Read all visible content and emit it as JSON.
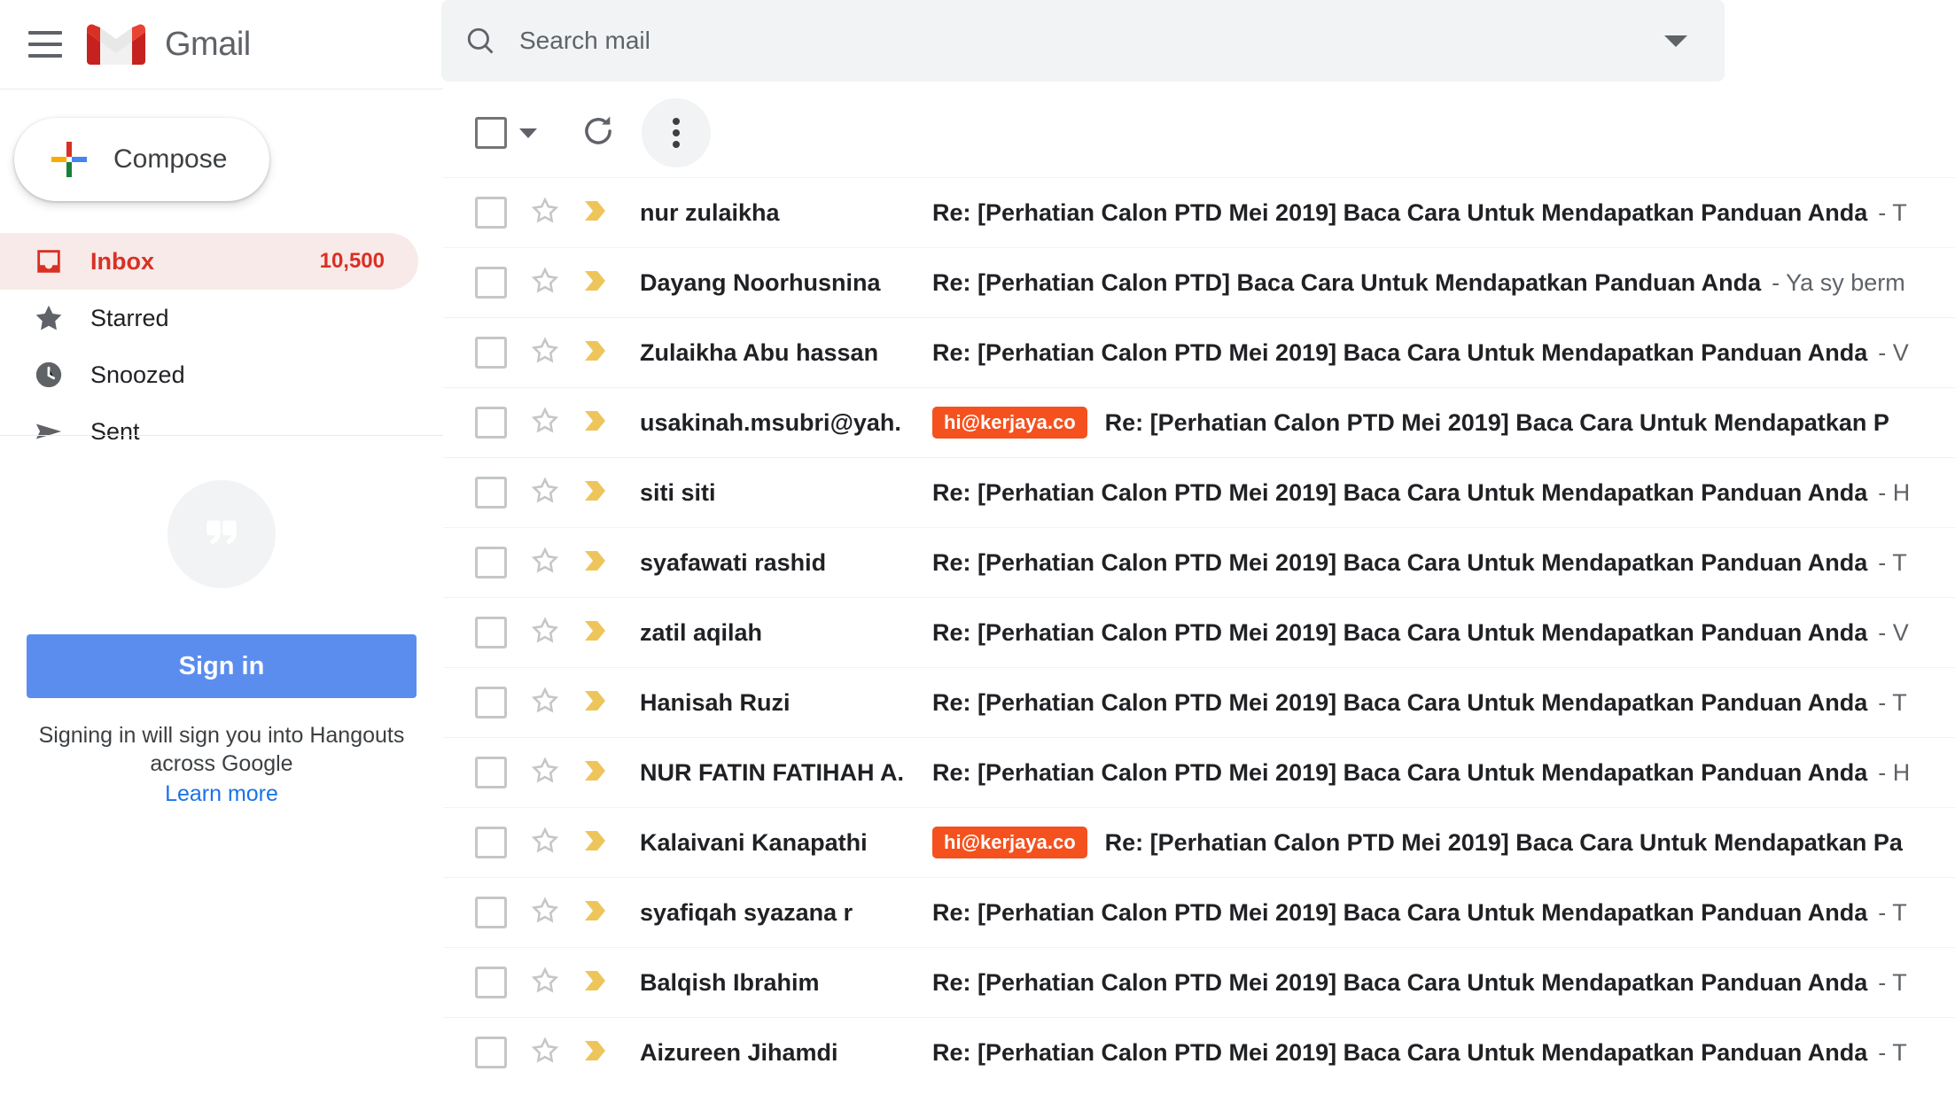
{
  "app": {
    "name": "Gmail",
    "menu_icon": "hamburger-menu-icon",
    "logo_icon": "gmail-logo-icon"
  },
  "search": {
    "placeholder": "Search mail",
    "value": "",
    "icon": "search-icon",
    "options_icon": "chevron-down-icon"
  },
  "sidebar": {
    "compose": {
      "label": "Compose",
      "icon": "plus-icon"
    },
    "items": [
      {
        "label": "Inbox",
        "icon": "inbox-icon",
        "count": "10,500",
        "active": true
      },
      {
        "label": "Starred",
        "icon": "star-icon",
        "count": "",
        "active": false
      },
      {
        "label": "Snoozed",
        "icon": "clock-icon",
        "count": "",
        "active": false
      },
      {
        "label": "Sent",
        "icon": "send-icon",
        "count": "",
        "active": false
      }
    ],
    "hangouts": {
      "icon": "hangouts-quote-icon",
      "signin_label": "Sign in",
      "note": "Signing in will sign you into Hangouts across Google",
      "learn_more": "Learn more"
    }
  },
  "toolbar": {
    "select_all_icon": "checkbox-icon",
    "select_dropdown_icon": "chevron-down-icon",
    "refresh_icon": "refresh-icon",
    "more_icon": "more-vertical-icon"
  },
  "mail_list": {
    "rows": [
      {
        "sender": "nur zulaikha",
        "chip": "",
        "subject": "Re: [Perhatian Calon PTD Mei 2019] Baca Cara Untuk Mendapatkan Panduan Anda",
        "snippet": "- T"
      },
      {
        "sender": "Dayang Noorhusnina",
        "chip": "",
        "subject": "Re: [Perhatian Calon PTD] Baca Cara Untuk Mendapatkan Panduan Anda",
        "snippet": "- Ya sy berm"
      },
      {
        "sender": "Zulaikha Abu hassan",
        "chip": "",
        "subject": "Re: [Perhatian Calon PTD Mei 2019] Baca Cara Untuk Mendapatkan Panduan Anda",
        "snippet": "- V"
      },
      {
        "sender": "usakinah.msubri@yah.",
        "chip": "hi@kerjaya.co",
        "subject": "Re: [Perhatian Calon PTD Mei 2019] Baca Cara Untuk Mendapatkan P",
        "snippet": ""
      },
      {
        "sender": "siti siti",
        "chip": "",
        "subject": "Re: [Perhatian Calon PTD Mei 2019] Baca Cara Untuk Mendapatkan Panduan Anda",
        "snippet": "- H"
      },
      {
        "sender": "syafawati rashid",
        "chip": "",
        "subject": "Re: [Perhatian Calon PTD Mei 2019] Baca Cara Untuk Mendapatkan Panduan Anda",
        "snippet": "- T"
      },
      {
        "sender": "zatil aqilah",
        "chip": "",
        "subject": "Re: [Perhatian Calon PTD Mei 2019] Baca Cara Untuk Mendapatkan Panduan Anda",
        "snippet": "- V"
      },
      {
        "sender": "Hanisah Ruzi",
        "chip": "",
        "subject": "Re: [Perhatian Calon PTD Mei 2019] Baca Cara Untuk Mendapatkan Panduan Anda",
        "snippet": "- T"
      },
      {
        "sender": "NUR FATIN FATIHAH A.",
        "chip": "",
        "subject": "Re: [Perhatian Calon PTD Mei 2019] Baca Cara Untuk Mendapatkan Panduan Anda",
        "snippet": "- H"
      },
      {
        "sender": "Kalaivani Kanapathi",
        "chip": "hi@kerjaya.co",
        "subject": "Re: [Perhatian Calon PTD Mei 2019] Baca Cara Untuk Mendapatkan Pa",
        "snippet": ""
      },
      {
        "sender": "syafiqah syazana r",
        "chip": "",
        "subject": "Re: [Perhatian Calon PTD Mei 2019] Baca Cara Untuk Mendapatkan Panduan Anda",
        "snippet": "- T"
      },
      {
        "sender": "Balqish Ibrahim",
        "chip": "",
        "subject": "Re: [Perhatian Calon PTD Mei 2019] Baca Cara Untuk Mendapatkan Panduan Anda",
        "snippet": "- T"
      },
      {
        "sender": "Aizureen Jihamdi",
        "chip": "",
        "subject": "Re: [Perhatian Calon PTD Mei 2019] Baca Cara Untuk Mendapatkan Panduan Anda",
        "snippet": "- T"
      }
    ]
  },
  "colors": {
    "accent_red": "#d93025",
    "inbox_highlight": "#f8eae8",
    "chip_orange": "#f4511e",
    "signin_blue": "#5b8def",
    "link_blue": "#1a73e8",
    "important_yellow": "#eec55a"
  }
}
